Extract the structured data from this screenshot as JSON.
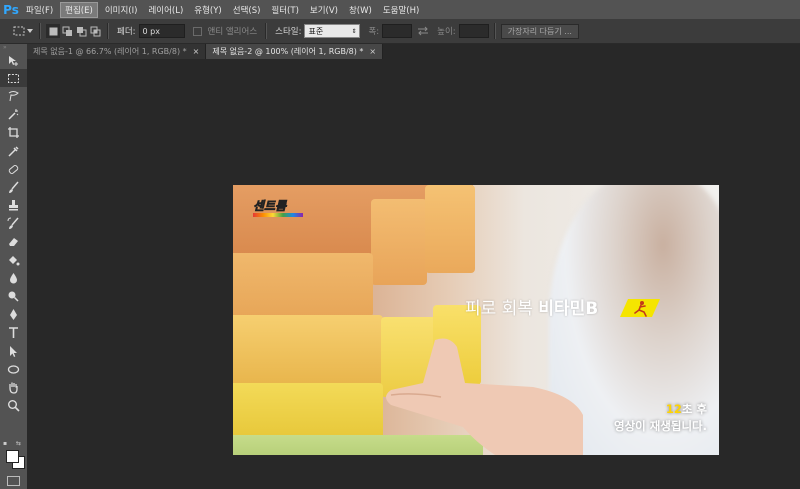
{
  "app": {
    "logo": "Ps"
  },
  "menu": {
    "items": [
      {
        "label": "파일(F)"
      },
      {
        "label": "편집(E)"
      },
      {
        "label": "이미지(I)"
      },
      {
        "label": "레이어(L)"
      },
      {
        "label": "유형(Y)"
      },
      {
        "label": "선택(S)"
      },
      {
        "label": "필터(T)"
      },
      {
        "label": "보기(V)"
      },
      {
        "label": "창(W)"
      },
      {
        "label": "도움말(H)"
      }
    ],
    "active_index": 1
  },
  "options": {
    "feather_label": "페더:",
    "feather_value": "0 px",
    "antialias_label": "앤티 앨리어스",
    "style_label": "스타일:",
    "style_value": "표준",
    "width_label": "폭:",
    "height_label": "높이:",
    "refine_button": "가장자리 다듬기 ..."
  },
  "tabs": [
    {
      "label": "제목 없음-1 @ 66.7% (레이어 1, RGB/8) *",
      "close": "×",
      "active": false
    },
    {
      "label": "제목 없음-2 @ 100% (레이어 1, RGB/8) *",
      "close": "×",
      "active": true
    }
  ],
  "tools": [
    "move-tool-icon",
    "marquee-tool-icon",
    "lasso-tool-icon",
    "quick-select-tool-icon",
    "crop-tool-icon",
    "eyedropper-tool-icon",
    "spot-healing-tool-icon",
    "brush-tool-icon",
    "clone-stamp-tool-icon",
    "history-brush-tool-icon",
    "eraser-tool-icon",
    "paint-bucket-tool-icon",
    "blur-tool-icon",
    "dodge-tool-icon",
    "pen-tool-icon",
    "type-tool-icon",
    "path-select-tool-icon",
    "shape-tool-icon",
    "hand-tool-icon",
    "zoom-tool-icon"
  ],
  "colors": {
    "foreground": "#ffffff",
    "background": "#ffffff",
    "accent": "#31a8ff"
  },
  "image": {
    "brand_logo": "센트룸",
    "slogan_regular": "피로 회복",
    "slogan_bold": "비타민B",
    "countdown_number": "12",
    "countdown_suffix": "초 후",
    "countdown_message": "영상이 재생됩니다."
  }
}
